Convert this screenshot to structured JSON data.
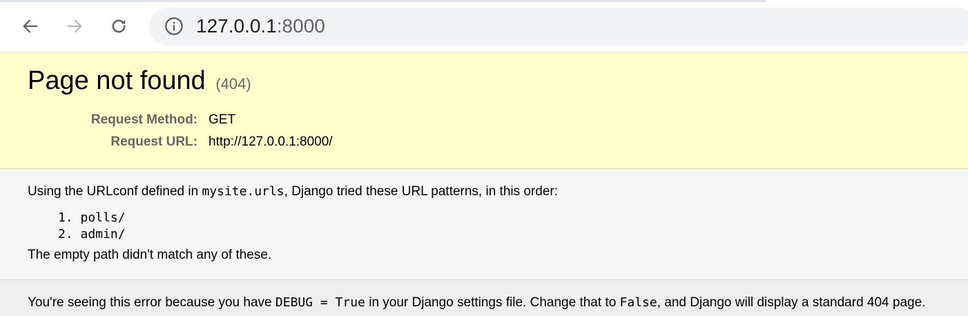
{
  "browser": {
    "back_icon": "arrow-left-icon",
    "forward_icon": "arrow-right-icon",
    "reload_icon": "reload-icon",
    "info_icon": "info-icon",
    "url_host": "127.0.0.1",
    "url_port": ":8000"
  },
  "summary": {
    "title": "Page not found",
    "status_code": "(404)",
    "request_method_label": "Request Method:",
    "request_method_value": "GET",
    "request_url_label": "Request URL:",
    "request_url_value": "http://127.0.0.1:8000/"
  },
  "info": {
    "urlconf_prefix": "Using the URLconf defined in ",
    "urlconf_module": "mysite.urls",
    "urlconf_suffix": ", Django tried these URL patterns, in this order:",
    "patterns": [
      "1. polls/",
      "2. admin/"
    ],
    "no_match": "The empty path didn't match any of these."
  },
  "explanation": {
    "part1": "You're seeing this error because you have ",
    "debug_setting": "DEBUG = True",
    "part2": " in your Django settings file. Change that to ",
    "false_value": "False",
    "part3": ", and Django will display a standard 404 page."
  }
}
